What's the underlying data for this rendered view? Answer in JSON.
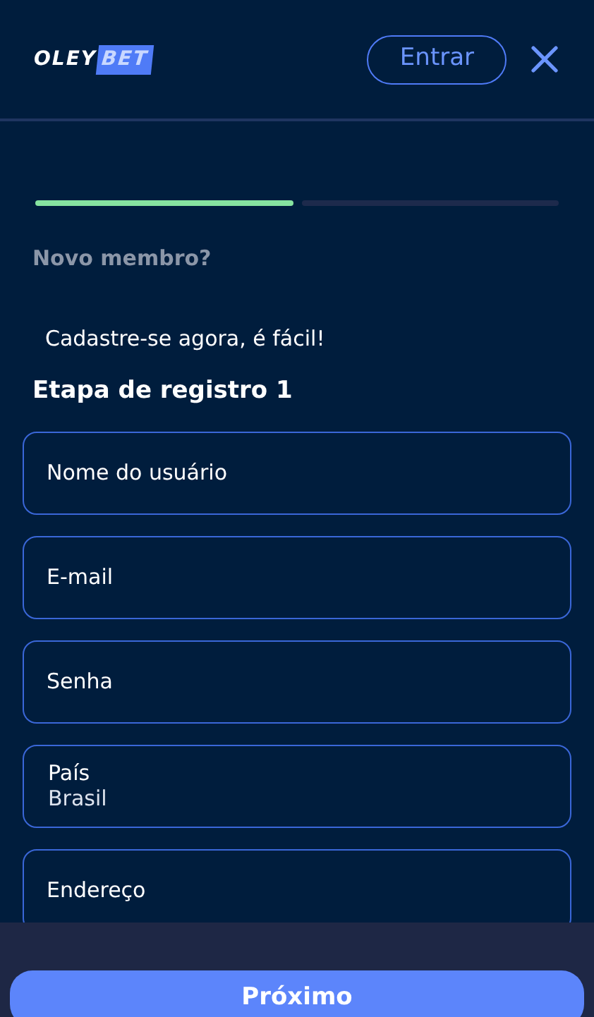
{
  "header": {
    "logo": {
      "part_1": "OLEY",
      "part_2": "BET"
    },
    "login_button": "Entrar"
  },
  "progress": [
    {
      "done": true
    },
    {
      "done": false
    }
  ],
  "subtitle": "Novo membro?",
  "intro": "Cadastre-se agora, é fácil!",
  "step_title": "Etapa de registro 1",
  "fields": [
    {
      "kind": "input",
      "placeholder": "Nome do usuário"
    },
    {
      "kind": "input",
      "placeholder": "E-mail"
    },
    {
      "kind": "input",
      "placeholder": "Senha"
    },
    {
      "kind": "select",
      "label": "País",
      "value": "Brasil"
    },
    {
      "kind": "input",
      "placeholder": "Endereço"
    }
  ],
  "next_button": "Próximo"
}
